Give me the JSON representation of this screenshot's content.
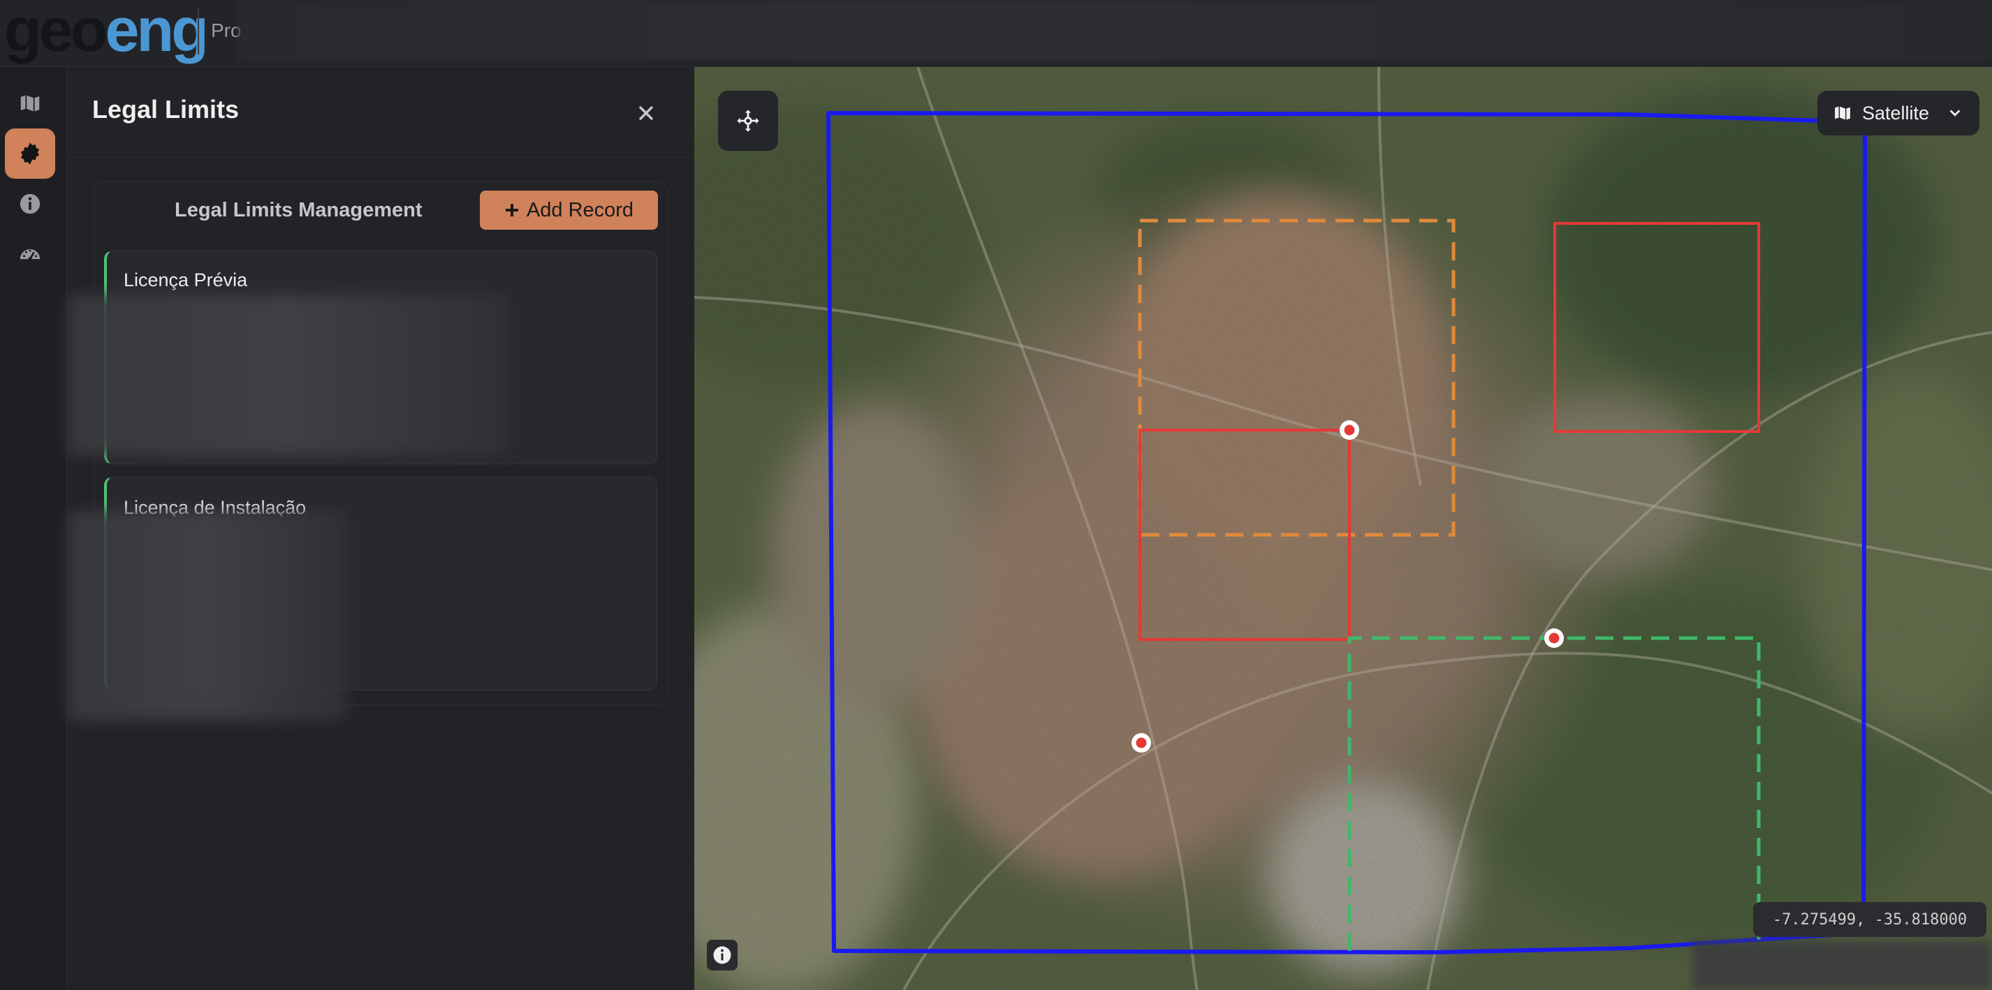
{
  "topbar": {
    "logo_part1": "geo",
    "logo_part2": "eng",
    "project_label": "Pro"
  },
  "sidebar_rail": {
    "items": [
      {
        "name": "map",
        "icon": "map-icon",
        "active": false
      },
      {
        "name": "legal-limits",
        "icon": "badge-seal-icon",
        "active": true
      },
      {
        "name": "info",
        "icon": "info-circle-icon",
        "active": false
      },
      {
        "name": "dashboard",
        "icon": "gauge-icon",
        "active": false
      }
    ],
    "active_color": "#d0825a"
  },
  "panel": {
    "title": "Legal Limits",
    "close_icon": "close-icon",
    "management_title": "Legal Limits Management",
    "add_button_label": "Add Record",
    "records": [
      {
        "title": "Licença Prévia",
        "accent": "#52c07a"
      },
      {
        "title": "Licença de Instalação",
        "accent": "#52c07a"
      }
    ]
  },
  "map": {
    "basemap": {
      "label": "Satellite",
      "icon": "map-icon",
      "chevron": "chevron-down-icon"
    },
    "coordinates": "-7.275499, -35.818000",
    "controls": {
      "recenter_icon": "crosshair-move-icon",
      "attribution_icon": "info-icon"
    },
    "overlay_colors": {
      "boundary": "#1a1af0",
      "orange_dashed": "#e08a3c",
      "red": "#e53935",
      "green_dashed": "#3fb86a",
      "marker": "#e53935"
    }
  }
}
